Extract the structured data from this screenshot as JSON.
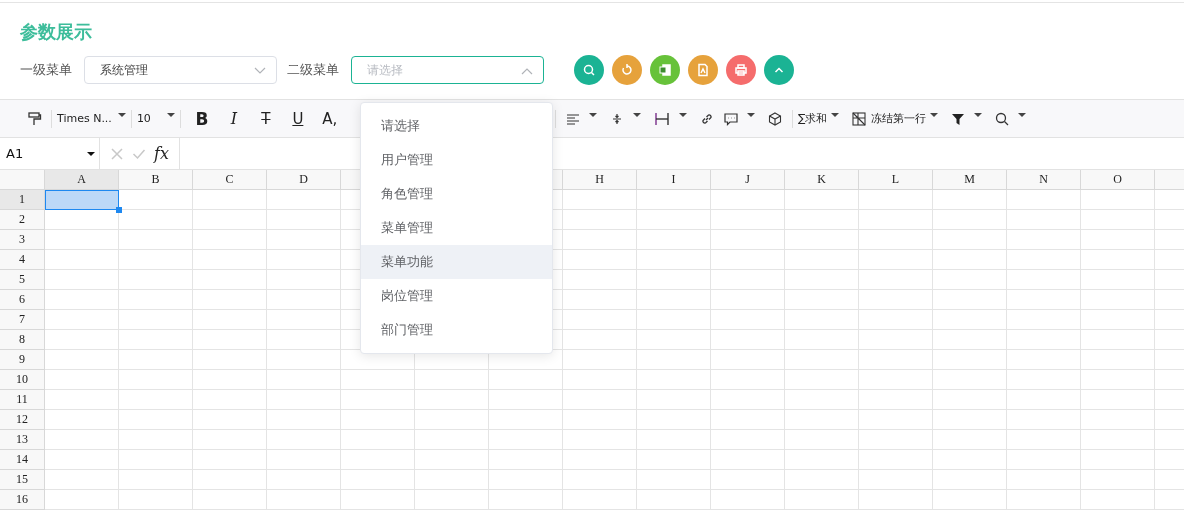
{
  "title": "参数展示",
  "filters": [
    {
      "label": "一级菜单",
      "value": "系统管理",
      "focused": false,
      "open": false
    },
    {
      "label": "二级菜单",
      "placeholder": "请选择",
      "focused": true,
      "open": true
    }
  ],
  "action_buttons": [
    {
      "kind": "search",
      "color": "#1bb394"
    },
    {
      "kind": "reset",
      "color": "#e6a23c"
    },
    {
      "kind": "excel",
      "color": "#67c23a"
    },
    {
      "kind": "pdf",
      "color": "#e6a23c"
    },
    {
      "kind": "print",
      "color": "#f56c6c"
    },
    {
      "kind": "collapse",
      "color": "#1bb394"
    }
  ],
  "dropdown": [
    {
      "label": "请选择",
      "selected": false,
      "hovered": false
    },
    {
      "label": "用户管理",
      "selected": false,
      "hovered": false
    },
    {
      "label": "角色管理",
      "selected": false,
      "hovered": false
    },
    {
      "label": "菜单管理",
      "selected": false,
      "hovered": false
    },
    {
      "label": "菜单功能",
      "selected": false,
      "hovered": true
    },
    {
      "label": "岗位管理",
      "selected": false,
      "hovered": false
    },
    {
      "label": "部门管理",
      "selected": false,
      "hovered": false
    }
  ],
  "toolbar": {
    "font": "Times N...",
    "size": "10",
    "format_buttons": [
      {
        "label": "B",
        "kind": "bold"
      },
      {
        "label": "I",
        "kind": "italic"
      },
      {
        "label": "T",
        "kind": "strike"
      },
      {
        "label": "U",
        "kind": "underline"
      },
      {
        "label": "A,",
        "kind": "plain"
      }
    ],
    "sum": "∑求和",
    "freeze": "冻结第一行"
  },
  "formula_bar": {
    "cell": "A1",
    "fx": "fx"
  },
  "sheet": {
    "columns_left": [
      {
        "label": "A",
        "selected": true
      },
      {
        "label": "B",
        "selected": false
      },
      {
        "label": "C",
        "selected": false
      },
      {
        "label": "D",
        "selected": false
      }
    ],
    "columns_right": [
      {
        "label": "H",
        "selected": false
      },
      {
        "label": "I",
        "selected": false
      },
      {
        "label": "J",
        "selected": false
      },
      {
        "label": "K",
        "selected": false
      },
      {
        "label": "L",
        "selected": false
      },
      {
        "label": "M",
        "selected": false
      },
      {
        "label": "N",
        "selected": false
      },
      {
        "label": "O",
        "selected": false
      }
    ],
    "rows": [
      {
        "label": "1",
        "selected": true
      },
      {
        "label": "2",
        "selected": false
      },
      {
        "label": "3",
        "selected": false
      },
      {
        "label": "4",
        "selected": false
      },
      {
        "label": "5",
        "selected": false
      },
      {
        "label": "6",
        "selected": false
      },
      {
        "label": "7",
        "selected": false
      },
      {
        "label": "8",
        "selected": false
      },
      {
        "label": "9",
        "selected": false
      },
      {
        "label": "10",
        "selected": false
      },
      {
        "label": "11",
        "selected": false
      },
      {
        "label": "12",
        "selected": false
      },
      {
        "label": "13",
        "selected": false
      },
      {
        "label": "14",
        "selected": false
      },
      {
        "label": "15",
        "selected": false
      },
      {
        "label": "16",
        "selected": false
      }
    ]
  }
}
